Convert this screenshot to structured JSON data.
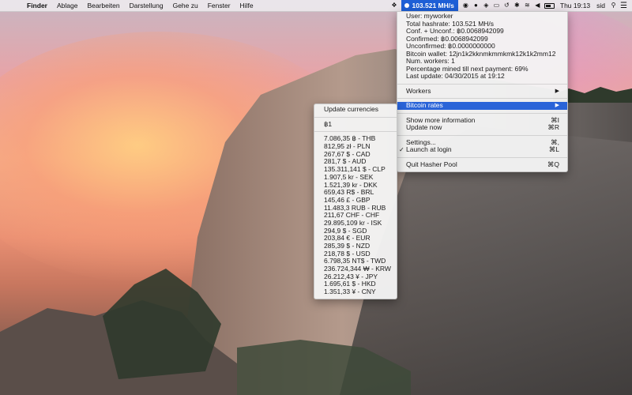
{
  "menubar": {
    "app": "Finder",
    "items": [
      "Ablage",
      "Bearbeiten",
      "Darstellung",
      "Gehe zu",
      "Fenster",
      "Hilfe"
    ],
    "hashrate": "103.521 MH/s",
    "clock": "Thu 19:13",
    "user": "sid"
  },
  "main_menu": {
    "info": [
      "User: myworker",
      "Total hashrate: 103.521 MH/s",
      "Conf. + Unconf.: ฿0.0068942099",
      "Confirmed: ฿0.0068942099",
      "Unconfirmed: ฿0.0000000000",
      "Bitcoin wallet: 12jn1k2kknmkmmkmk12k1k2mm12",
      "Num. workers: 1",
      "Percentage mined till next payment: 69%",
      "Last update: 04/30/2015 at 19:12"
    ],
    "workers": "Workers",
    "bitcoin_rates": "Bitcoin rates",
    "show_more": "Show more information",
    "show_more_shortcut": "⌘I",
    "update_now": "Update now",
    "update_now_shortcut": "⌘R",
    "settings": "Settings...",
    "settings_shortcut": "⌘,",
    "launch_at_login": "Launch at login",
    "launch_at_login_shortcut": "⌘L",
    "quit": "Quit Hasher Pool",
    "quit_shortcut": "⌘Q"
  },
  "rates_menu": {
    "update": "Update currencies",
    "base": "฿1",
    "rates": [
      "7.086,35 ฿ - THB",
      "812,95 zł - PLN",
      "267,67 $ - CAD",
      "281,7 $ - AUD",
      "135.311,141 $ - CLP",
      "1.907,5 kr - SEK",
      "1.521,39 kr - DKK",
      "659,43 R$ - BRL",
      "145,46 £ - GBP",
      "11.483,3 RUB - RUB",
      "211,67 CHF - CHF",
      "29.895,109 kr - ISK",
      "294,9 $ - SGD",
      "203,84 € - EUR",
      "285,39 $ - NZD",
      "218,78 $ - USD",
      "6.798,35 NT$ - TWD",
      "236.724,344 ₩ - KRW",
      "26.212,43 ¥ - JPY",
      "1.695,61 $ - HKD",
      "1.351,33 ¥ - CNY"
    ]
  }
}
